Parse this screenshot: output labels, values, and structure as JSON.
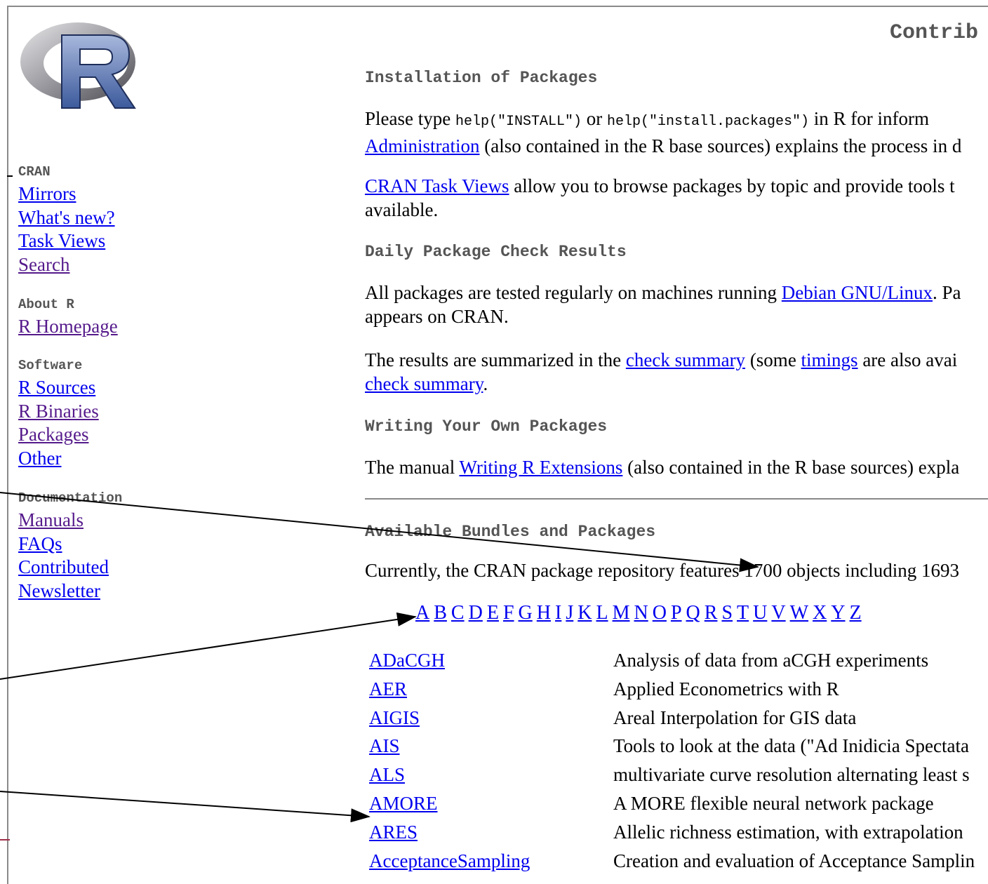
{
  "page_title": "Contrib",
  "sidebar": {
    "sections": [
      {
        "header": "CRAN",
        "items": [
          "Mirrors",
          "What's new?",
          "Task Views",
          "Search"
        ]
      },
      {
        "header": "About R",
        "items": [
          "R Homepage"
        ]
      },
      {
        "header": "Software",
        "items": [
          "R Sources",
          "R Binaries",
          "Packages",
          "Other"
        ]
      },
      {
        "header": "Documentation",
        "items": [
          "Manuals",
          "FAQs",
          "Contributed",
          "Newsletter"
        ]
      }
    ]
  },
  "install": {
    "heading": "Installation of Packages",
    "p1_a": "Please type ",
    "code1": "help(\"INSTALL\")",
    "p1_b": " or ",
    "code2": "help(\"install.packages\")",
    "p1_c": " in R for inform",
    "p1_link": "Administration",
    "p1_d": " (also contained in the R base sources) explains the process in d",
    "p2_link": "CRAN Task Views",
    "p2_a": " allow you to browse packages by topic and provide tools t",
    "p2_b": "available."
  },
  "checks": {
    "heading": "Daily Package Check Results",
    "p1_a": "All packages are tested regularly on machines running ",
    "p1_link": "Debian GNU/Linux",
    "p1_b": ". Pa",
    "p1_c": "appears on CRAN.",
    "p2_a": "The results are summarized in the ",
    "p2_link1": "check summary",
    "p2_b": " (some ",
    "p2_link2": "timings",
    "p2_c": " are also avai",
    "p2_link3": "check summary",
    "p2_d": "."
  },
  "writing": {
    "heading": "Writing Your Own Packages",
    "p1_a": "The manual ",
    "p1_link": "Writing R Extensions",
    "p1_b": " (also contained in the R base sources) expla"
  },
  "available": {
    "heading": "Available Bundles and Packages",
    "p1": "Currently, the CRAN package repository features 1700 objects including 1693"
  },
  "letters": [
    "A",
    "B",
    "C",
    "D",
    "E",
    "F",
    "G",
    "H",
    "I",
    "J",
    "K",
    "L",
    "M",
    "N",
    "O",
    "P",
    "Q",
    "R",
    "S",
    "T",
    "U",
    "V",
    "W",
    "X",
    "Y",
    "Z"
  ],
  "packages": [
    {
      "name": "ADaCGH",
      "desc": "Analysis of data from aCGH experiments"
    },
    {
      "name": "AER",
      "desc": "Applied Econometrics with R"
    },
    {
      "name": "AIGIS",
      "desc": "Areal Interpolation for GIS data"
    },
    {
      "name": "AIS",
      "desc": "Tools to look at the data (\"Ad Inidicia Spectata"
    },
    {
      "name": "ALS",
      "desc": "multivariate curve resolution alternating least s"
    },
    {
      "name": "AMORE",
      "desc": "A MORE flexible neural network package"
    },
    {
      "name": "ARES",
      "desc": "Allelic richness estimation, with extrapolation"
    },
    {
      "name": "AcceptanceSampling",
      "desc": "Creation and evaluation of Acceptance Samplin"
    }
  ],
  "colors": {
    "link": "#0000ee",
    "visited": "#551a8b",
    "heading": "#555555",
    "rule": "#888888"
  }
}
